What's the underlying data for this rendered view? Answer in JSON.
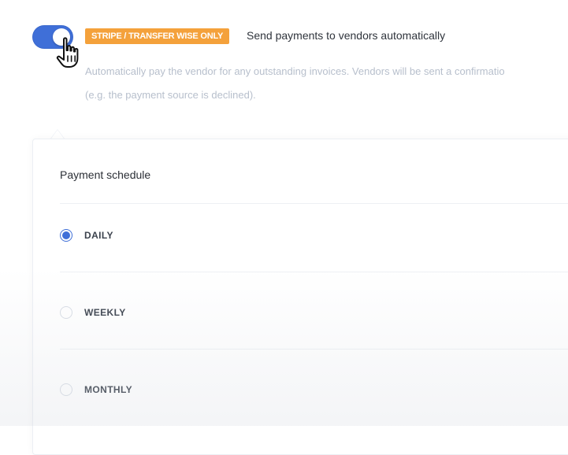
{
  "automation": {
    "toggle_state": "on",
    "badge": "STRIPE / TRANSFER WISE ONLY",
    "title": "Send payments to vendors automatically",
    "description_line1": "Automatically pay the vendor for any outstanding invoices. Vendors will be sent a confirmatio",
    "description_line2": "(e.g. the payment source is declined)."
  },
  "schedule": {
    "label": "Payment schedule",
    "options": [
      {
        "label": "DAILY",
        "selected": true
      },
      {
        "label": "WEEKLY",
        "selected": false
      },
      {
        "label": "MONTHLY",
        "selected": false
      }
    ]
  },
  "colors": {
    "accent": "#3f6fd8",
    "badge": "#f4a13b",
    "muted_text": "#b7bfcc"
  },
  "icons": {
    "cursor": "hand-pointer-icon"
  }
}
